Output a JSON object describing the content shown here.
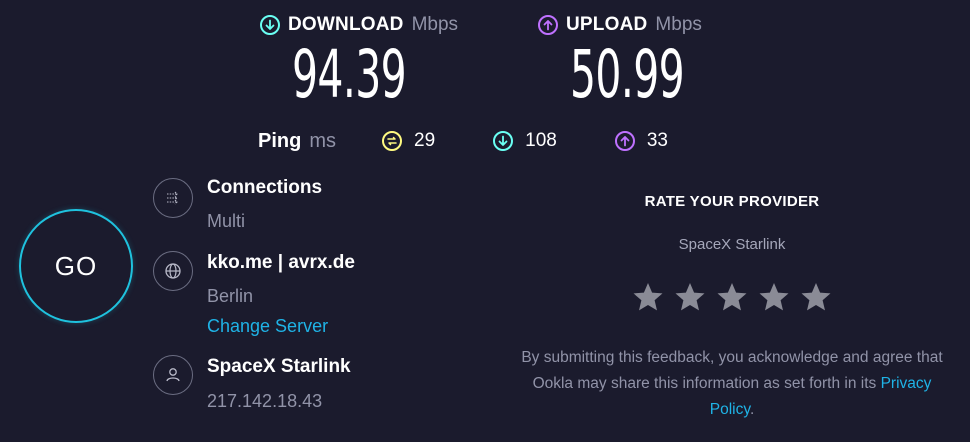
{
  "download": {
    "label": "DOWNLOAD",
    "unit": "Mbps",
    "value": "94.39",
    "icon": "arrow-down-circle-icon"
  },
  "upload": {
    "label": "UPLOAD",
    "unit": "Mbps",
    "value": "50.99",
    "icon": "arrow-up-circle-icon"
  },
  "ping": {
    "label": "Ping",
    "unit": "ms",
    "idle": "29",
    "download": "108",
    "upload": "33"
  },
  "go_label": "GO",
  "connections": {
    "title": "Connections",
    "value": "Multi"
  },
  "server": {
    "title": "kko.me | avrx.de",
    "location": "Berlin",
    "change_link": "Change Server"
  },
  "provider": {
    "title": "SpaceX Starlink",
    "ip": "217.142.18.43"
  },
  "rating": {
    "heading": "RATE YOUR PROVIDER",
    "provider_name": "SpaceX Starlink",
    "stars": 5,
    "note_text": "By submitting this feedback, you acknowledge and agree that Ookla may share this information as set forth in its ",
    "policy_link": "Privacy Policy",
    "note_end": "."
  },
  "colors": {
    "background": "#1b1b2d",
    "download_accent": "#6afff3",
    "upload_accent": "#bf71ff",
    "ping_accent": "#fffa81",
    "go_ring": "#1fc2de",
    "link": "#1fb3e6",
    "muted": "#9193a8"
  }
}
